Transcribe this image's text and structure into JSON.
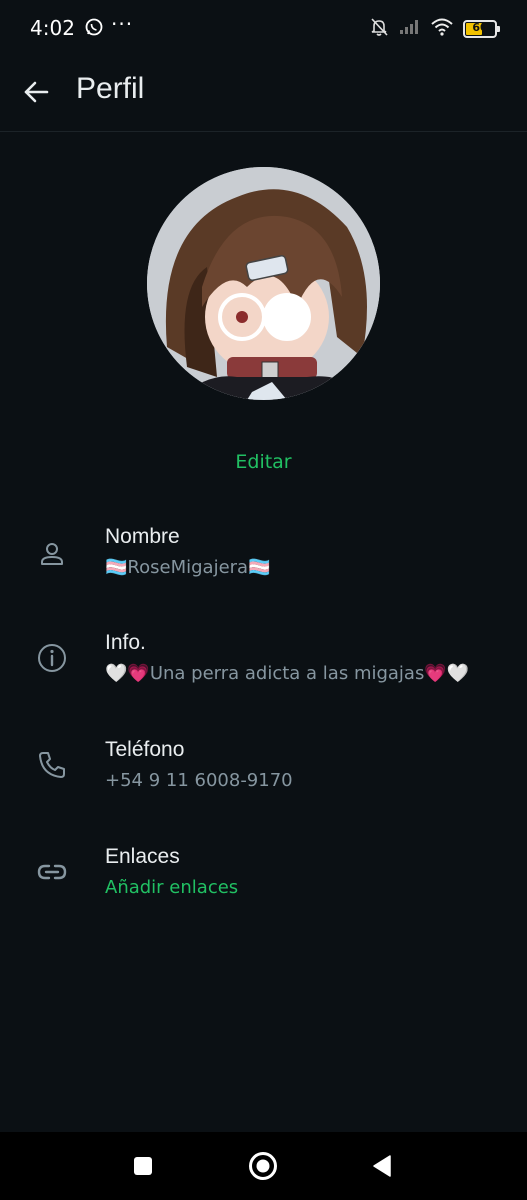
{
  "status_bar": {
    "time": "4:02",
    "more": "···",
    "battery": "60",
    "battery_level_percent": 60,
    "icons": [
      "whatsapp-icon",
      "bell-off-icon",
      "signal-icon",
      "wifi-icon",
      "battery-icon"
    ]
  },
  "app_bar": {
    "title": "Perfil",
    "back_icon": "arrow-left-icon"
  },
  "profile": {
    "edit_label": "Editar"
  },
  "rows": [
    {
      "icon": "person-icon",
      "label": "Nombre",
      "value": "🏳️‍⚧️RoseMigajera🏳️‍⚧️"
    },
    {
      "icon": "info-icon",
      "label": "Info.",
      "value": "🤍💗Una perra adicta a las migajas💗🤍"
    },
    {
      "icon": "phone-icon",
      "label": "Teléfono",
      "value": "+54 9 11 6008-9170"
    },
    {
      "icon": "link-icon",
      "label": "Enlaces",
      "value": "Añadir enlaces"
    }
  ],
  "nav_bar": {
    "buttons": [
      "recents-square-icon",
      "home-circle-icon",
      "back-triangle-icon"
    ]
  },
  "colors": {
    "background": "#0b1014",
    "accent_green": "#21c063",
    "secondary_text": "#8696a0",
    "battery_yellow": "#f2c200"
  }
}
